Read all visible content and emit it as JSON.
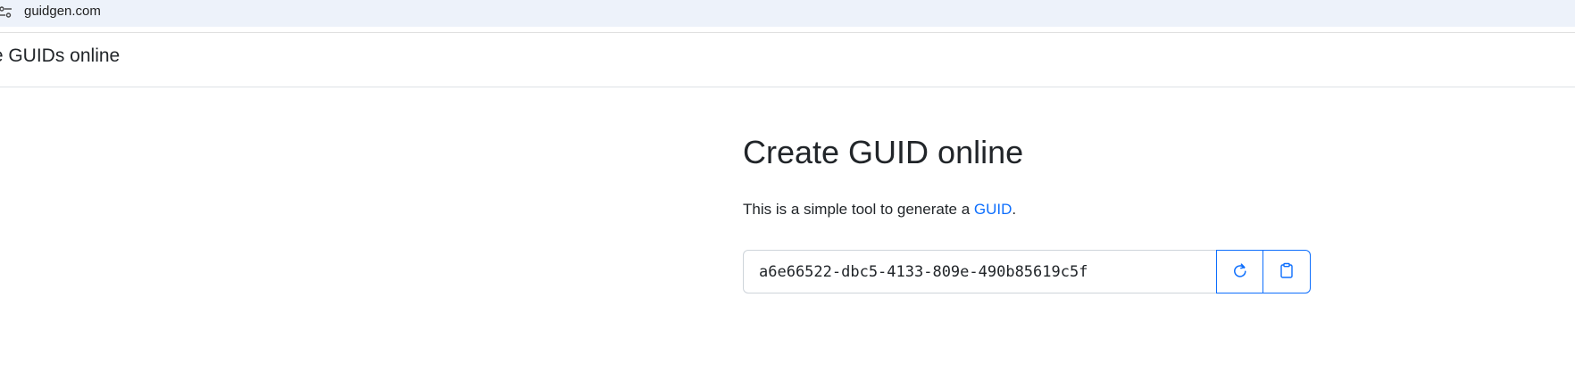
{
  "browser": {
    "url": "guidgen.com"
  },
  "navbar": {
    "brand": "te GUIDs online"
  },
  "main": {
    "title": "Create GUID online",
    "lead_prefix": "This is a simple tool to generate a ",
    "lead_link": "GUID",
    "lead_suffix": ".",
    "guid_value": "a6e66522-dbc5-4133-809e-490b85619c5f"
  },
  "icons": {
    "site_info": "tune-icon",
    "refresh": "refresh-icon",
    "copy": "clipboard-icon"
  },
  "colors": {
    "primary": "#0d6efd",
    "address_bar": "#edf2fa",
    "text": "#212529"
  }
}
